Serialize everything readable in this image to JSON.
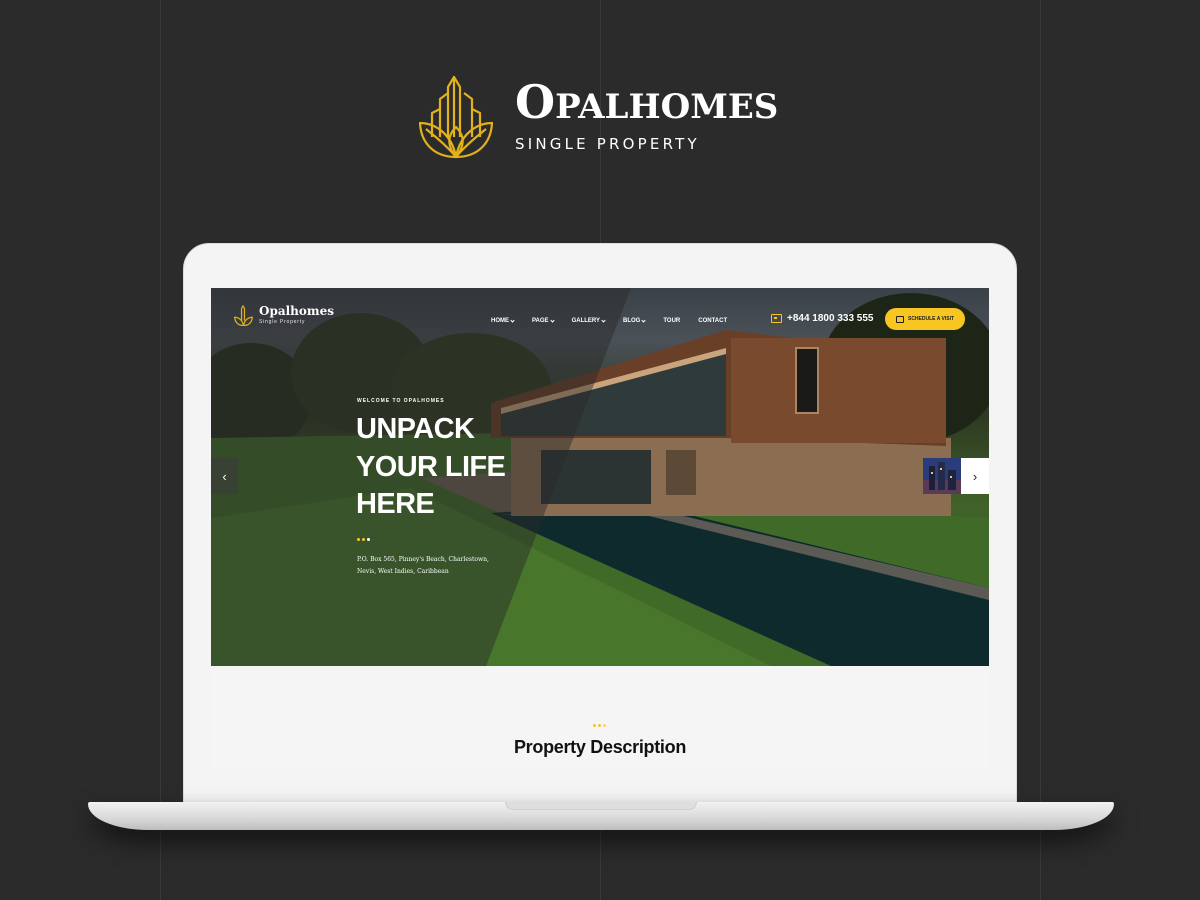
{
  "brand": {
    "name_first": "O",
    "name_rest": "PALHOMES",
    "tagline": "SINGLE PROPERTY",
    "logo_icon": "building-leaf-logo"
  },
  "site": {
    "logo_name": "Opalhomes",
    "logo_tagline": "Single Property",
    "menu": [
      {
        "label": "HOME",
        "dropdown": true
      },
      {
        "label": "PAGE",
        "dropdown": true
      },
      {
        "label": "GALLERY",
        "dropdown": true
      },
      {
        "label": "BLOG",
        "dropdown": true
      },
      {
        "label": "TOUR",
        "dropdown": false
      },
      {
        "label": "CONTACT",
        "dropdown": false
      }
    ],
    "phone": "+844 1800 333 555",
    "cta_label": "SCHEDULE A VISIT",
    "hero": {
      "kicker": "WELCOME TO OPALHOMES",
      "headline_1": "UNPACK",
      "headline_2": "YOUR LIFE",
      "headline_3": "HERE",
      "address_1": "P.O. Box 565, Pinney's Beach, Charlestown,",
      "address_2": "Nevis, West Indies, Caribbean",
      "prev_arrow": "‹",
      "next_arrow": "›"
    },
    "section_title": "Property Description"
  },
  "colors": {
    "accent": "#f7c623",
    "background": "#2b2b2b",
    "logo_gold": "#e2b21d"
  }
}
